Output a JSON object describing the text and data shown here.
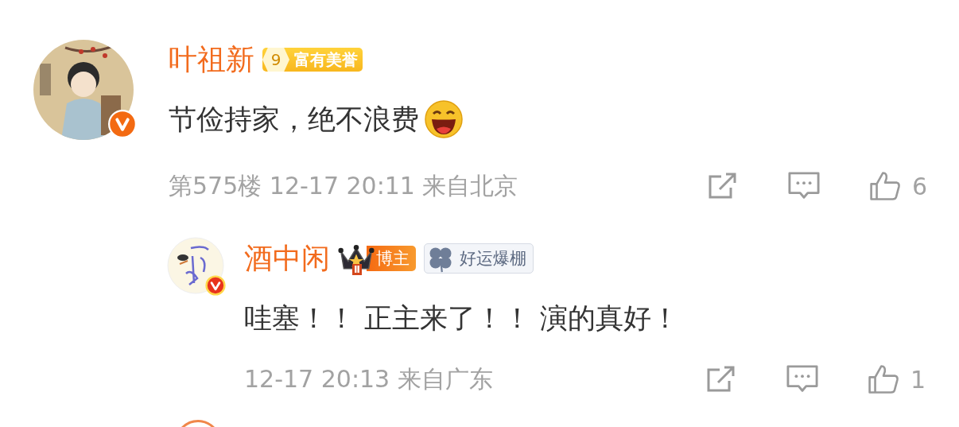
{
  "comment": {
    "name": "叶祖新",
    "verified": true,
    "badges": [
      {
        "kind": "level",
        "level_text": "9",
        "label": "富有美誉"
      }
    ],
    "text": "节俭持家，绝不浪费",
    "emoji": true,
    "floor": "第575楼",
    "time": "12-17 20:11",
    "location": "来自北京",
    "likes": "6",
    "replies": [
      {
        "name": "酒中闲",
        "verified": true,
        "badges": [
          {
            "kind": "crown",
            "rank": "Ⅱ",
            "label": "博主"
          },
          {
            "kind": "clover",
            "label": "好运爆棚"
          }
        ],
        "text": "哇塞！！ 正主来了！！ 演的真好！",
        "emoji": false,
        "time": "12-17 20:13",
        "location": "来自广东",
        "likes": "1"
      }
    ]
  }
}
